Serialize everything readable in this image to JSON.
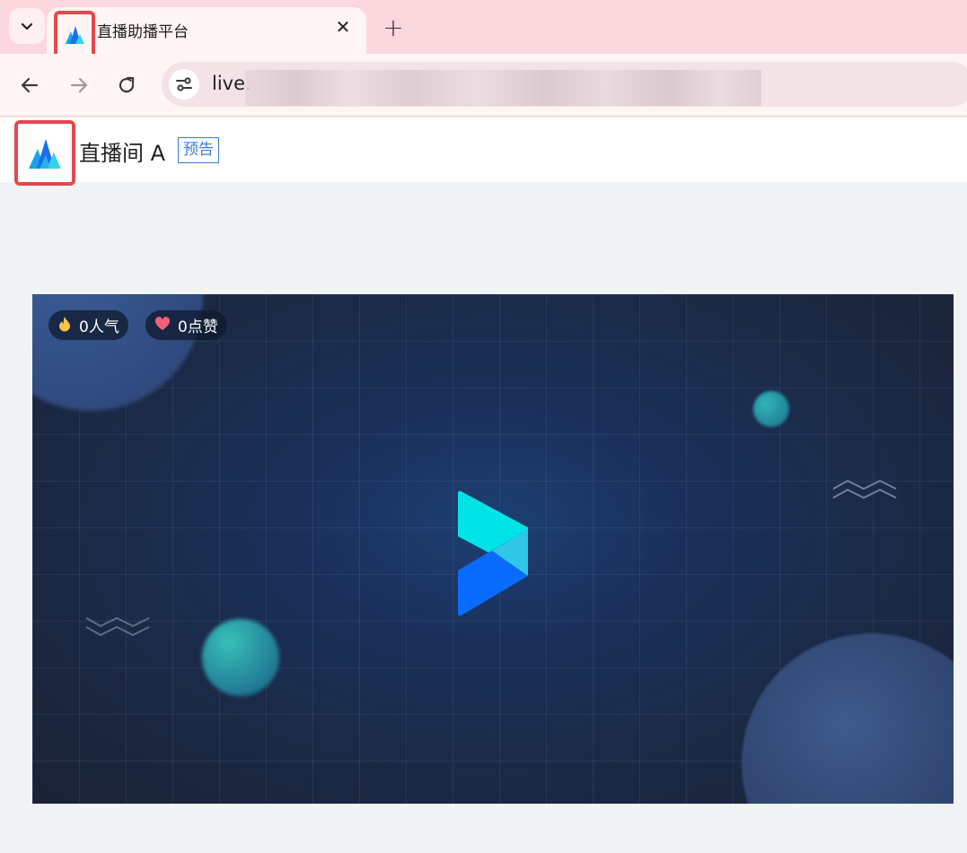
{
  "browser": {
    "tab_title": "直播助播平台",
    "tab_close": "✕",
    "new_tab": "+",
    "url": "live."
  },
  "header": {
    "room_title": "直播间 A",
    "status_badge": "预告"
  },
  "player": {
    "popularity": "0人气",
    "likes": "0点赞"
  },
  "colors": {
    "highlight_border": "#e5484d",
    "badge_blue": "#3a7bd5",
    "play_cyan": "#00e5e5",
    "play_blue": "#0a6cff"
  },
  "icons": [
    "tab-list-icon",
    "app-logo-icon",
    "close-icon",
    "plus-icon",
    "back-arrow-icon",
    "forward-arrow-icon",
    "reload-icon",
    "site-settings-icon",
    "fire-icon",
    "heart-icon",
    "play-logo-icon"
  ]
}
